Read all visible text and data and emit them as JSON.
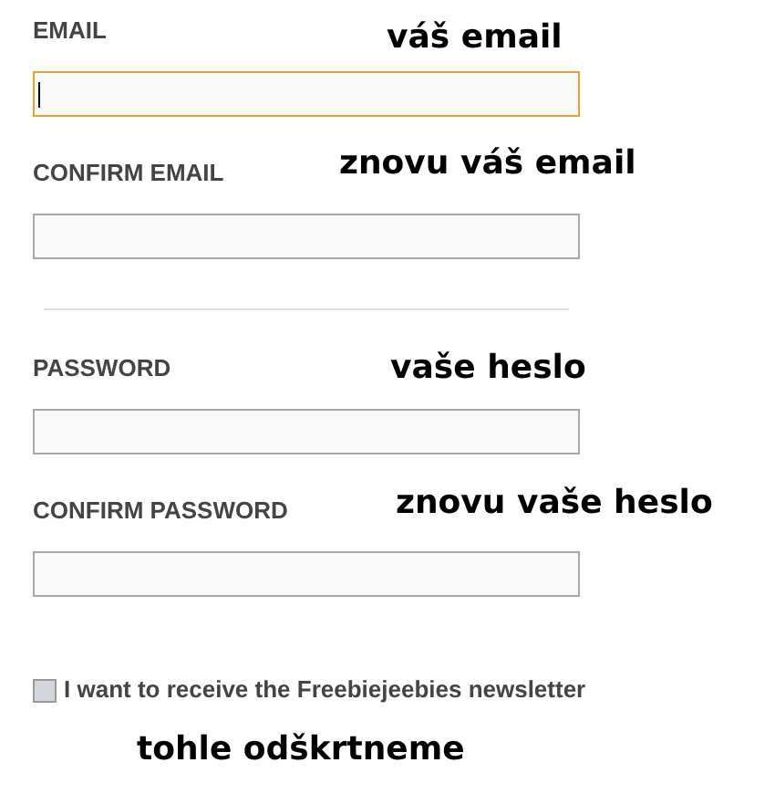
{
  "fields": [
    {
      "label": "EMAIL",
      "annotation": "váš email",
      "focused": true
    },
    {
      "label": "CONFIRM EMAIL",
      "annotation": "znovu váš email",
      "focused": false
    },
    {
      "label": "PASSWORD",
      "annotation": "vaše heslo",
      "focused": false
    },
    {
      "label": "CONFIRM PASSWORD",
      "annotation": "znovu vaše heslo",
      "focused": false
    }
  ],
  "newsletter": {
    "label": "I want to receive the Freebiejeebies newsletter",
    "checked": false,
    "annotation": "tohle odškrtneme"
  }
}
